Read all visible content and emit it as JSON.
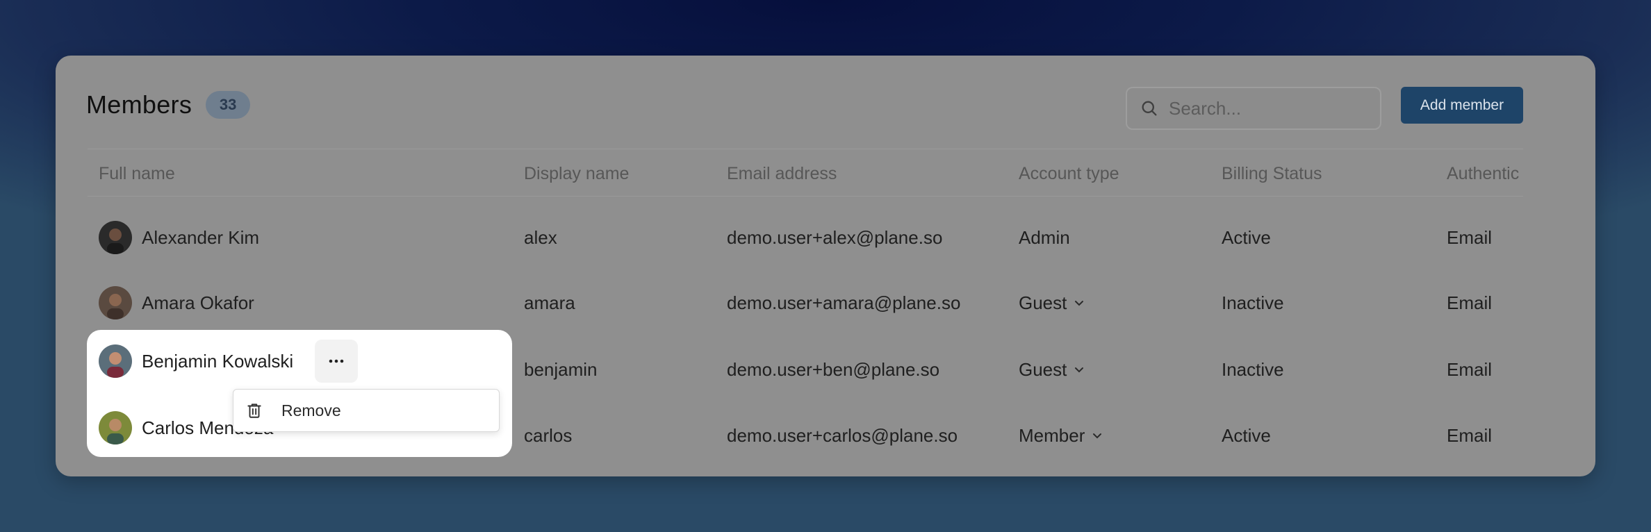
{
  "header": {
    "title": "Members",
    "count": "33"
  },
  "search": {
    "placeholder": "Search..."
  },
  "actions": {
    "add_member": "Add member"
  },
  "columns": [
    "Full name",
    "Display name",
    "Email address",
    "Account type",
    "Billing Status",
    "Authentic"
  ],
  "rows": [
    {
      "full_name": "Alexander Kim",
      "display_name": "alex",
      "email": "demo.user+alex@plane.so",
      "account_type": "Admin",
      "billing_status": "Active",
      "auth": "Email"
    },
    {
      "full_name": "Amara Okafor",
      "display_name": "amara",
      "email": "demo.user+amara@plane.so",
      "account_type": "Guest",
      "billing_status": "Inactive",
      "auth": "Email"
    },
    {
      "full_name": "Benjamin Kowalski",
      "display_name": "benjamin",
      "email": "demo.user+ben@plane.so",
      "account_type": "Guest",
      "billing_status": "Inactive",
      "auth": "Email"
    },
    {
      "full_name": "Carlos Mendoza",
      "display_name": "carlos",
      "email": "demo.user+carlos@plane.so",
      "account_type": "Member",
      "billing_status": "Active",
      "auth": "Email"
    }
  ],
  "context_menu": {
    "remove": "Remove"
  },
  "colors": {
    "accent": "#1e4468",
    "card_dim": "#8f8f8f"
  }
}
